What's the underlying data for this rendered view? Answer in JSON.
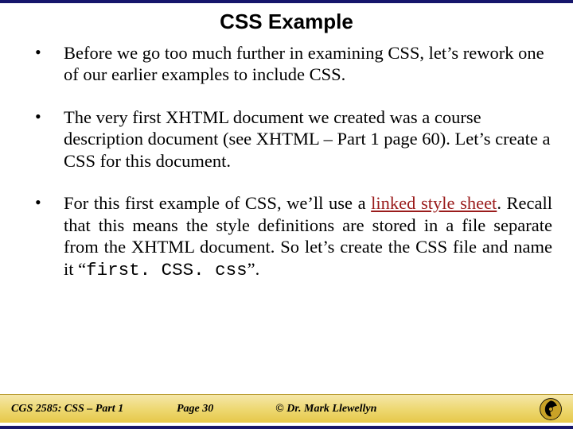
{
  "title": "CSS Example",
  "bullets": [
    {
      "text": "Before we go too much further in examining CSS, let’s rework one of our earlier examples to include CSS.",
      "justify": false
    },
    {
      "text": "The very first XHTML document we created was a course description document (see XHTML – Part 1 page 60).  Let’s create a CSS for this document.",
      "justify": false
    },
    {
      "pre": "For this first example of CSS, we’ll use a ",
      "linked": "linked style sheet",
      "mid": ".   Recall that this means the style definitions are stored in a file separate from the XHTML document.  So let’s create the CSS file and name it “",
      "code": "first. CSS. css",
      "post": "”.",
      "justify": true
    }
  ],
  "footer": {
    "course": "CGS 2585: CSS – Part 1",
    "page": "Page  30",
    "copyright": "© Dr. Mark Llewellyn"
  }
}
